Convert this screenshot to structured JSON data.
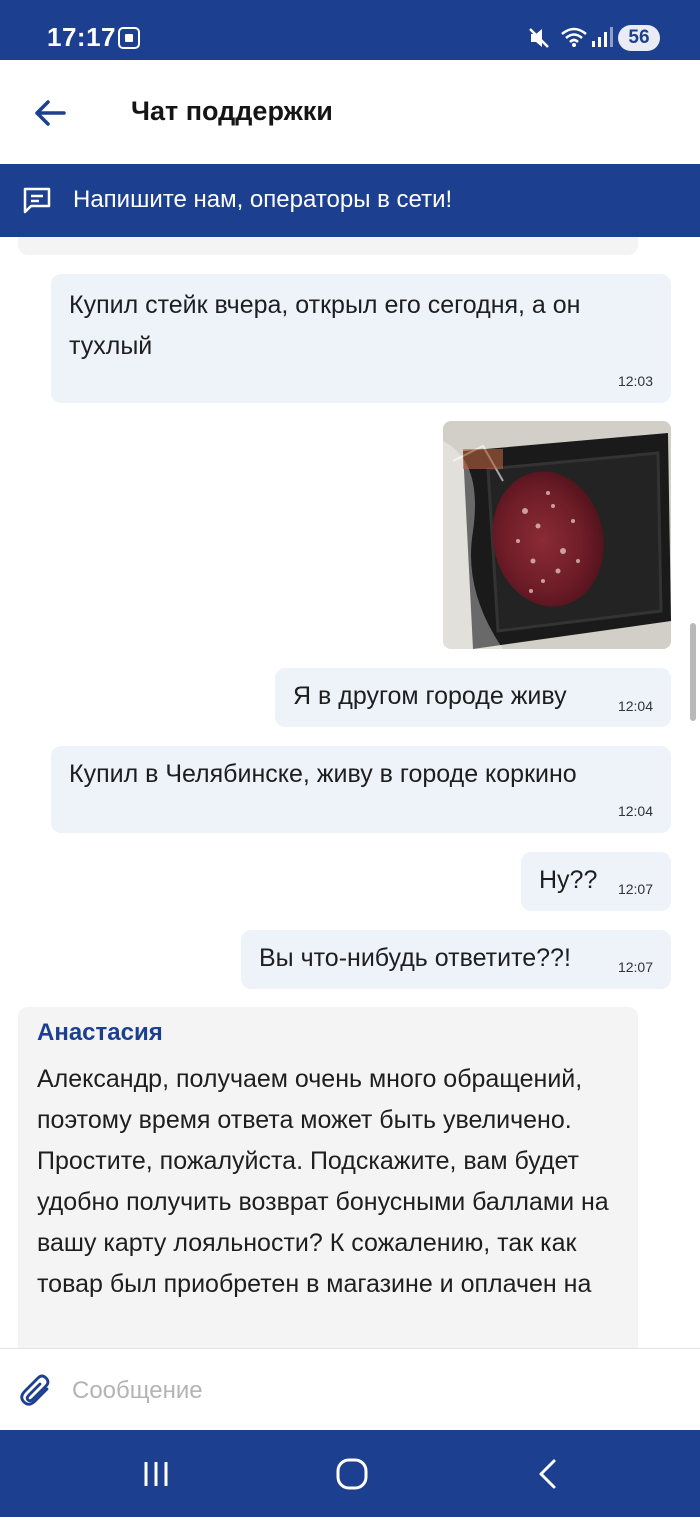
{
  "status_bar": {
    "time": "17:17",
    "battery": "56",
    "icons": [
      "screenshot-icon",
      "mute-icon",
      "wifi-icon",
      "signal-icon",
      "battery-icon"
    ]
  },
  "header": {
    "title": "Чат поддержки",
    "back_icon": "arrow-left-icon"
  },
  "banner": {
    "text": "Напишите нам, операторы в сети!",
    "icon": "chat-icon"
  },
  "messages": [
    {
      "text": "Купил стейк вчера, открыл его сегодня, а он тухлый",
      "time": "12:03"
    },
    {
      "type": "image",
      "description_icon": "photo-icon"
    },
    {
      "text": "Я в другом городе живу",
      "time": "12:04"
    },
    {
      "text": "Купил в Челябинске, живу в городе коркино",
      "time": "12:04"
    },
    {
      "text": "Ну??",
      "time": "12:07"
    },
    {
      "text": "Вы что-нибудь ответите??!",
      "time": "12:07"
    }
  ],
  "operator": {
    "name": "Анастасия",
    "text": "Александр, получаем очень много обращений, поэтому время ответа может быть увеличено. Простите, пожалуйста. Подскажите, вам будет удобно получить возврат бонусными баллами на вашу карту лояльности? К сожалению, так как товар был приобретен в магазине и оплачен на"
  },
  "input": {
    "placeholder": "Сообщение",
    "value": ""
  },
  "colors": {
    "brand": "#1d3f8f",
    "bubble_user": "#eef3fa",
    "bubble_operator": "#f4f4f5"
  }
}
